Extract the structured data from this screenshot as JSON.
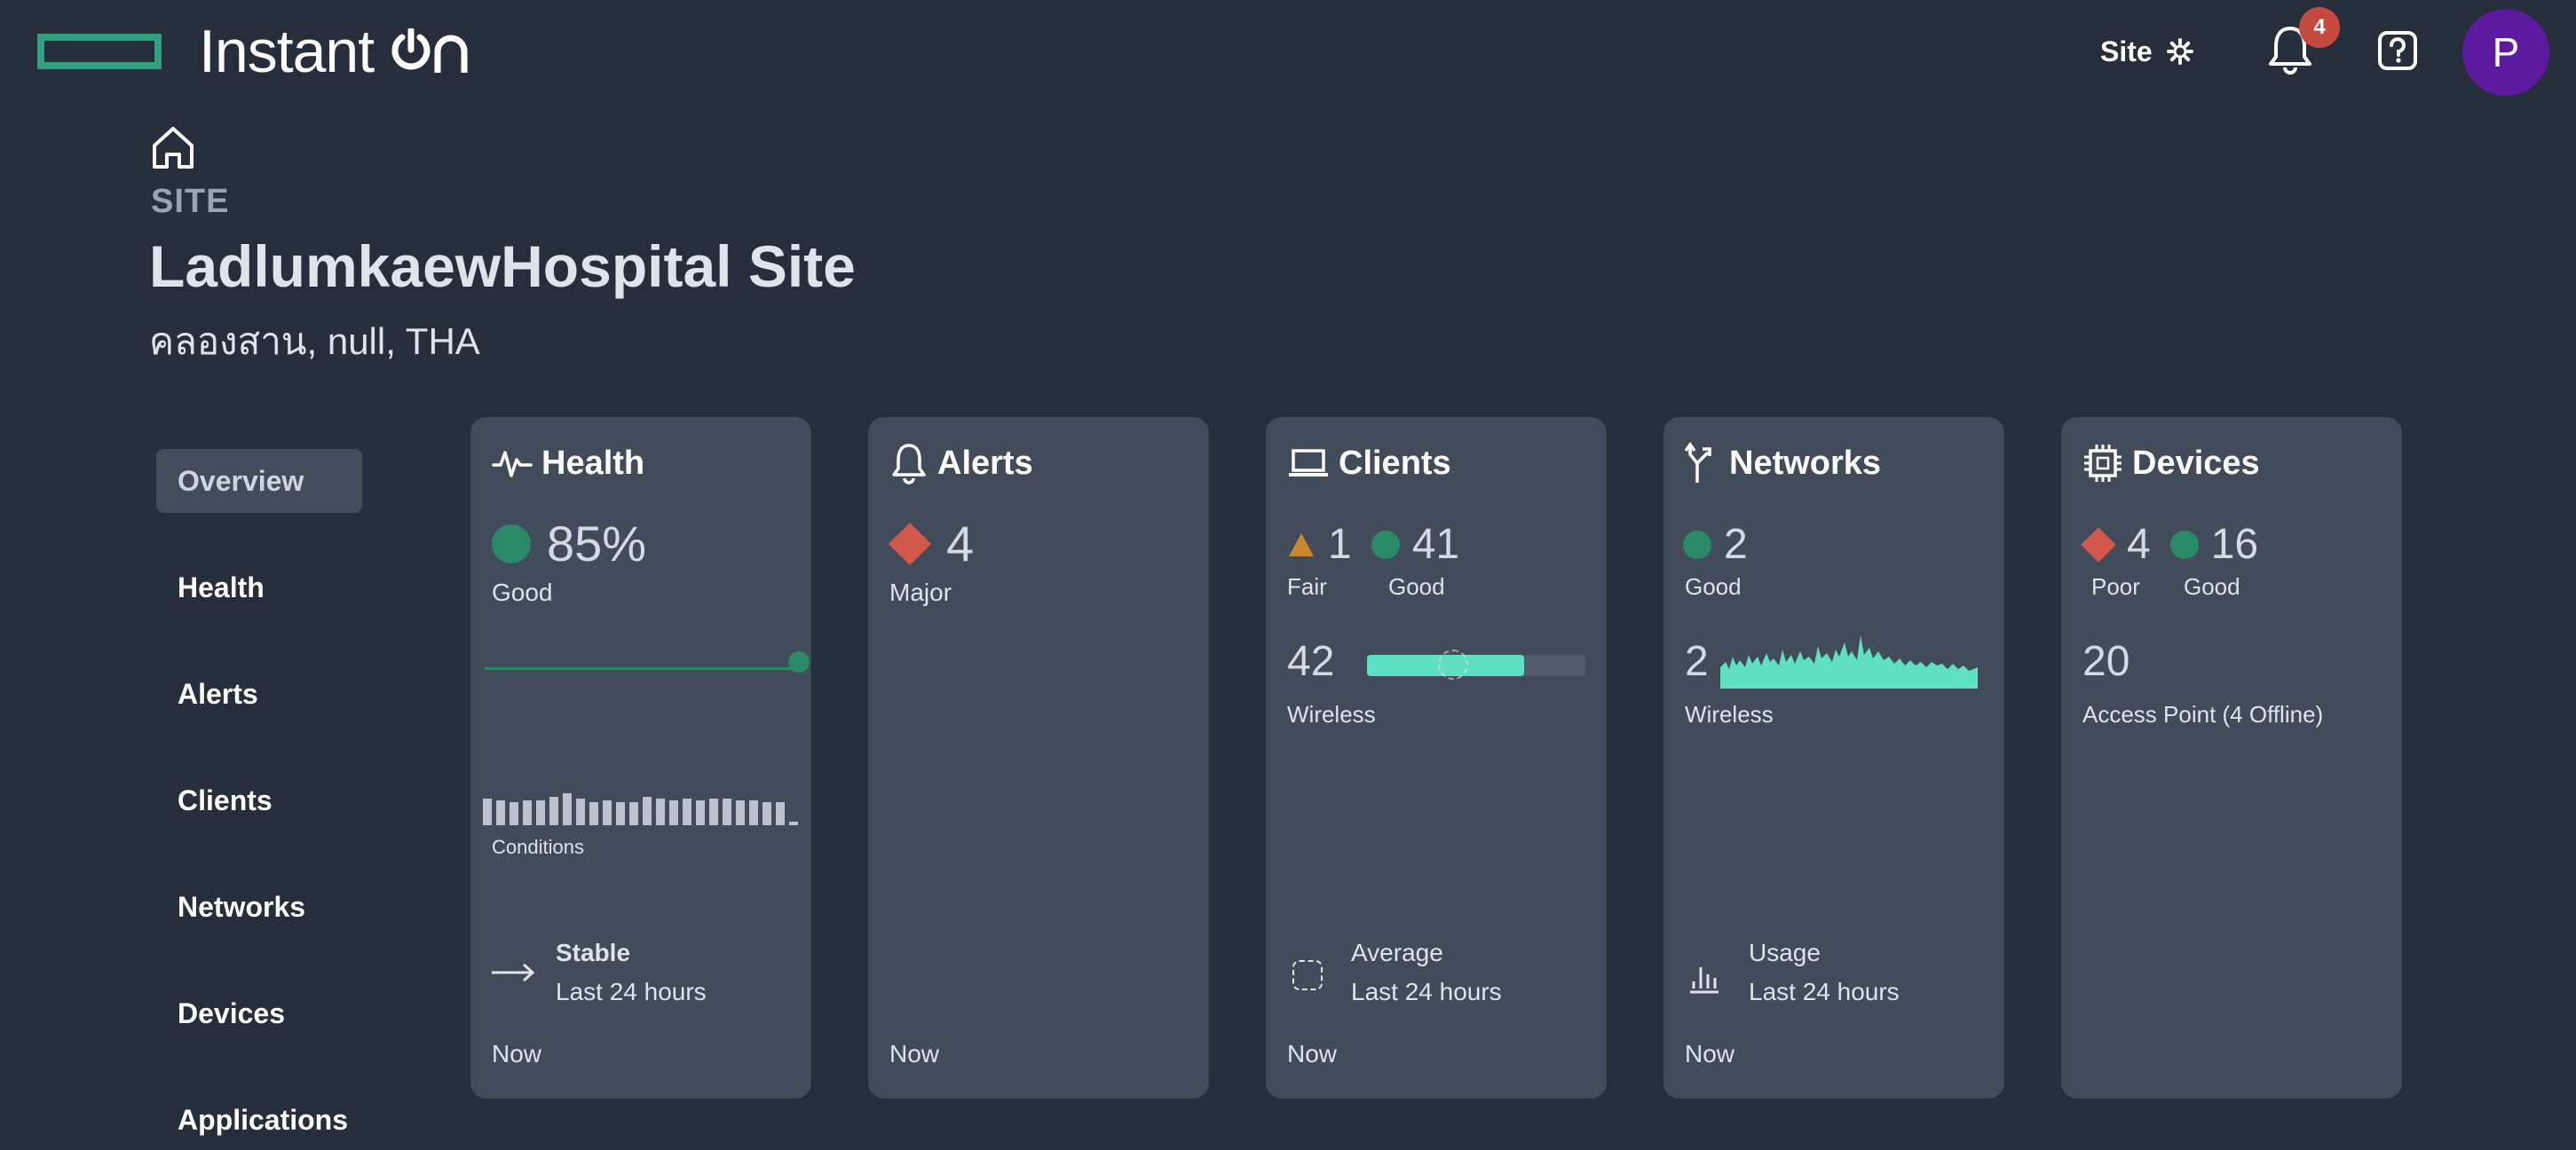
{
  "header": {
    "brand": "Instant",
    "site_button": "Site",
    "notification_count": "4",
    "avatar_initial": "P",
    "colors": {
      "brand_green": "#30a07f",
      "avatar": "#5c1a9e",
      "badge": "#c4493e"
    }
  },
  "site": {
    "label": "SITE",
    "name": "LadlumkaewHospital Site",
    "location": "คลองสาน, null, THA"
  },
  "nav": {
    "items": [
      "Overview",
      "Health",
      "Alerts",
      "Clients",
      "Networks",
      "Devices",
      "Applications"
    ],
    "active": "Overview"
  },
  "cards": {
    "health": {
      "title": "Health",
      "percent": "85%",
      "status": "Good",
      "conditions_label": "Conditions",
      "trend_label": "Stable",
      "period": "Last 24 hours",
      "now": "Now"
    },
    "alerts": {
      "title": "Alerts",
      "count": "4",
      "severity": "Major",
      "now": "Now"
    },
    "clients": {
      "title": "Clients",
      "fair_count": "1",
      "fair_label": "Fair",
      "good_count": "41",
      "good_label": "Good",
      "wireless_count": "42",
      "wireless_label": "Wireless",
      "wireless_fill_fraction": 0.72,
      "avg_label": "Average",
      "period": "Last 24 hours",
      "now": "Now"
    },
    "networks": {
      "title": "Networks",
      "good_count": "2",
      "good_label": "Good",
      "wireless_count": "2",
      "wireless_label": "Wireless",
      "usage_label": "Usage",
      "period": "Last 24 hours",
      "now": "Now"
    },
    "devices": {
      "title": "Devices",
      "poor_count": "4",
      "poor_label": "Poor",
      "good_count": "16",
      "good_label": "Good",
      "total": "20",
      "ap_label": "Access Point (4 Offline)"
    }
  }
}
